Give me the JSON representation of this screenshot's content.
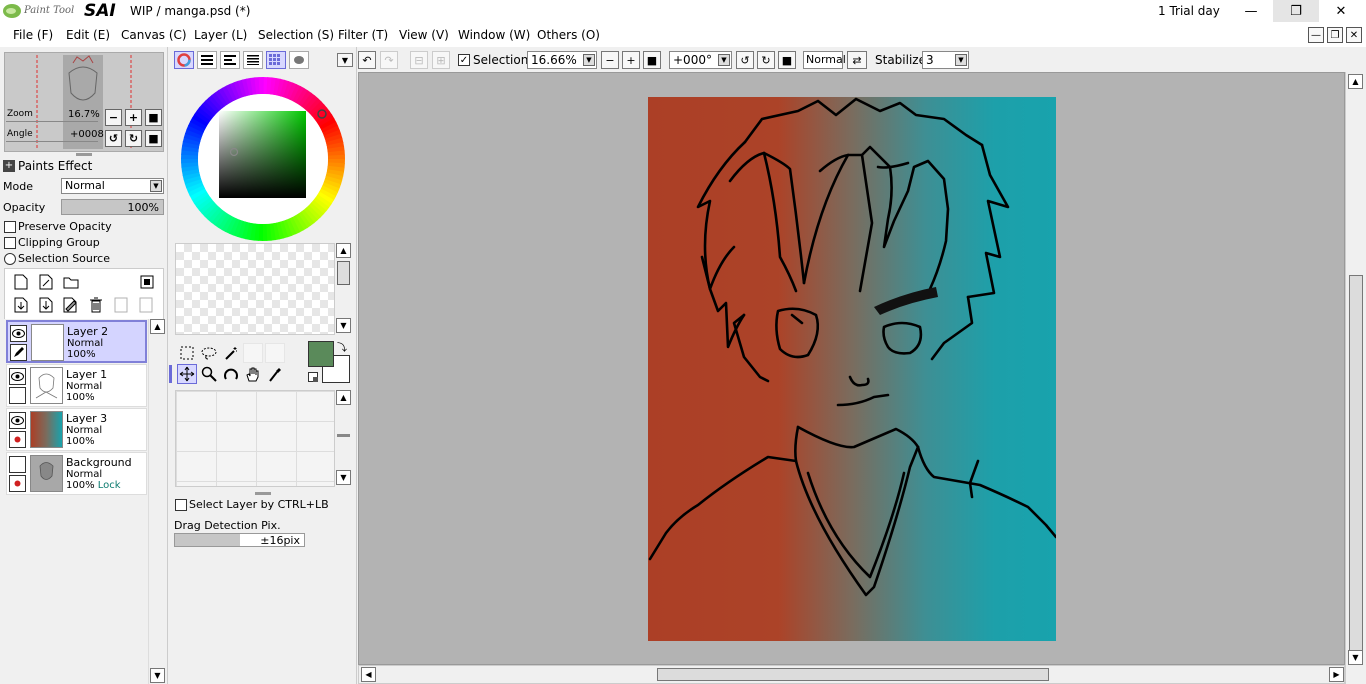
{
  "app": {
    "name_small": "Paint Tool",
    "name_big": "SAI",
    "title": "WIP / manga.psd (*)",
    "trial": "1 Trial day"
  },
  "window_buttons": {
    "minimize": "—",
    "restore": "❐",
    "close": "✕"
  },
  "menu": [
    "File (F)",
    "Edit (E)",
    "Canvas (C)",
    "Layer (L)",
    "Selection (S)",
    "Filter (T)",
    "View (V)",
    "Window (W)",
    "Others (O)"
  ],
  "navigator": {
    "zoom_label": "Zoom",
    "zoom_value": "16.7%",
    "angle_label": "Angle",
    "angle_value": "+0008"
  },
  "paints_effect": "Paints Effect",
  "mode": {
    "label": "Mode",
    "value": "Normal"
  },
  "opacity": {
    "label": "Opacity",
    "value": "100%",
    "fraction": 1.0
  },
  "checks": {
    "preserve_opacity": "Preserve Opacity",
    "clipping_group": "Clipping Group",
    "selection_source": "Selection Source"
  },
  "layers": [
    {
      "name": "Layer 2",
      "mode": "Normal",
      "opacity": "100%",
      "lock": "",
      "active": true
    },
    {
      "name": "Layer 1",
      "mode": "Normal",
      "opacity": "100%",
      "lock": "",
      "active": false
    },
    {
      "name": "Layer 3",
      "mode": "Normal",
      "opacity": "100%",
      "lock": "",
      "active": false
    },
    {
      "name": "Background",
      "mode": "Normal",
      "opacity": "100%",
      "lock": "Lock",
      "active": false
    }
  ],
  "colors": {
    "primary": "#5a8a5a",
    "secondary": "#ffffff",
    "accent": "#6b6bd8",
    "canvas_bg": "#b3b3b3",
    "grad_left": "#ac3f26",
    "grad_right": "#18a3ad"
  },
  "tool_options": {
    "select_layer": "Select Layer by CTRL+LB",
    "drag_detection_label": "Drag Detection Pix.",
    "drag_detection_value": "±16pix",
    "drag_fraction": 0.5
  },
  "toolbar": {
    "selection_label": "Selection",
    "zoom": "16.66%",
    "rotation": "+000°",
    "blend": "Normal",
    "stabilizer_label": "Stabilizer",
    "stabilizer_value": "3"
  }
}
